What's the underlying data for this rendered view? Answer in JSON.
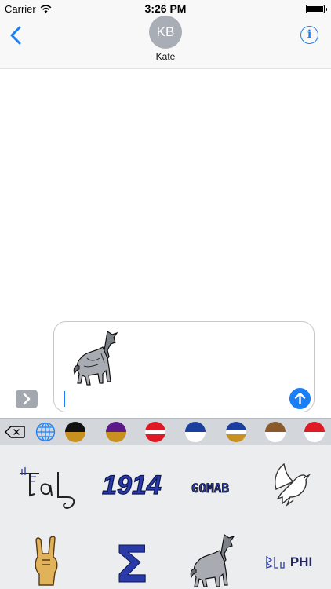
{
  "status_bar": {
    "carrier": "Carrier",
    "time": "3:26 PM",
    "battery_level": 1.0
  },
  "header": {
    "avatar_initials": "KB",
    "contact_name": "Kate",
    "back_icon": "chevron-left-icon",
    "info_icon": "info-circle-icon",
    "info_label": "i"
  },
  "compose": {
    "attached_sticker": "howling-wolf-sticker",
    "send_icon": "arrow-up-icon",
    "expand_icon": "chevron-right-icon"
  },
  "tray": {
    "delete_icon": "backspace-icon",
    "globe_icon": "globe-icon",
    "swatches": [
      {
        "name": "black-gold",
        "top": "#111111",
        "bottom": "#c8911f"
      },
      {
        "name": "purple-gold",
        "top": "#5c1a88",
        "bottom": "#c8911f"
      },
      {
        "name": "red-white",
        "top": "#e01a24",
        "bottom": "#e01a24",
        "middle": "#ffffff"
      },
      {
        "name": "blue-white",
        "top": "#1a3f9e",
        "bottom": "#ffffff"
      },
      {
        "name": "blue-gold",
        "top": "#1a3f9e",
        "bottom": "#c8911f",
        "middle": "#ffffff"
      },
      {
        "name": "brown-white",
        "top": "#8a5a2b",
        "bottom": "#ffffff"
      },
      {
        "name": "red-white-2",
        "top": "#e01a24",
        "bottom": "#ffffff"
      }
    ],
    "stickers": [
      {
        "name": "tau-script-sticker",
        "text": "tau"
      },
      {
        "name": "1914-sticker",
        "text": "1914"
      },
      {
        "name": "gomab-sticker",
        "text": "GOMAB"
      },
      {
        "name": "dove-sticker"
      },
      {
        "name": "hand-sign-sticker"
      },
      {
        "name": "sigma-sticker",
        "text": "Σ"
      },
      {
        "name": "wolf-sticker"
      },
      {
        "name": "blu-phi-sticker",
        "text": "PHI"
      }
    ]
  },
  "colors": {
    "accent": "#1a7ef5",
    "avatar_bg": "#a9adb5",
    "sticker_blue": "#2a3aa8"
  }
}
